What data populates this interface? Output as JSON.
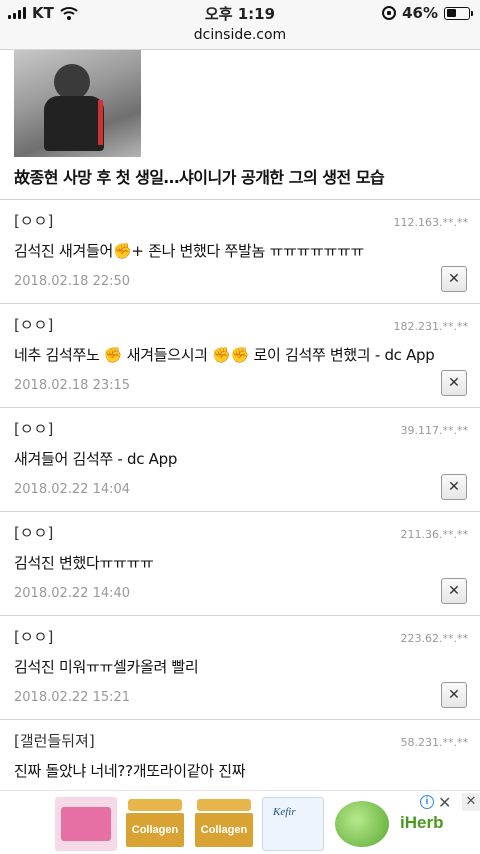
{
  "status_bar": {
    "carrier": "KT",
    "time": "오후 1:19",
    "battery": "46%",
    "battery_level": 0.46
  },
  "url_bar": {
    "url": "dcinside.com"
  },
  "article": {
    "title": "故종현 사망 후 첫 생일…샤이니가 공개한 그의 생전 모습"
  },
  "comments": [
    {
      "author": "[ㅇㅇ]",
      "ip": "112.163.**.**",
      "text": "김석진 새겨들어✊+ 존나 변했다 쭈발놈 ㅠㅠㅠㅠㅠㅠㅠ",
      "date": "2018.02.18 22:50",
      "delete_label": "✕"
    },
    {
      "author": "[ㅇㅇ]",
      "ip": "182.231.**.**",
      "text": "네추 김석쭈노 ✊ 새겨들으시긔 ✊✊ 로이 김석쭈 변했긔 - dc App",
      "date": "2018.02.18 23:15",
      "delete_label": "✕"
    },
    {
      "author": "[ㅇㅇ]",
      "ip": "39.117.**.**",
      "text": "새겨들어 김석쭈 - dc App",
      "date": "2018.02.22 14:04",
      "delete_label": "✕"
    },
    {
      "author": "[ㅇㅇ]",
      "ip": "211.36.**.**",
      "text": "김석진 변했다ㅠㅠㅠㅠ",
      "date": "2018.02.22 14:40",
      "delete_label": "✕"
    },
    {
      "author": "[ㅇㅇ]",
      "ip": "223.62.**.**",
      "text": "김석진 미워ㅠㅠ셀카올려 빨리",
      "date": "2018.02.22 15:21",
      "delete_label": "✕"
    },
    {
      "author": "[갤런들뒤져]",
      "ip": "58.231.**.**",
      "text": "진짜 돌았냐 너네??개또라이같아 진짜"
    }
  ],
  "ad": {
    "product_label": "Collagen",
    "product_label_2": "Collagen",
    "kefir_label": "Kefir",
    "brand": "iHerb",
    "info_label": "i",
    "close_label": "✕",
    "close_label_2": "✕"
  }
}
